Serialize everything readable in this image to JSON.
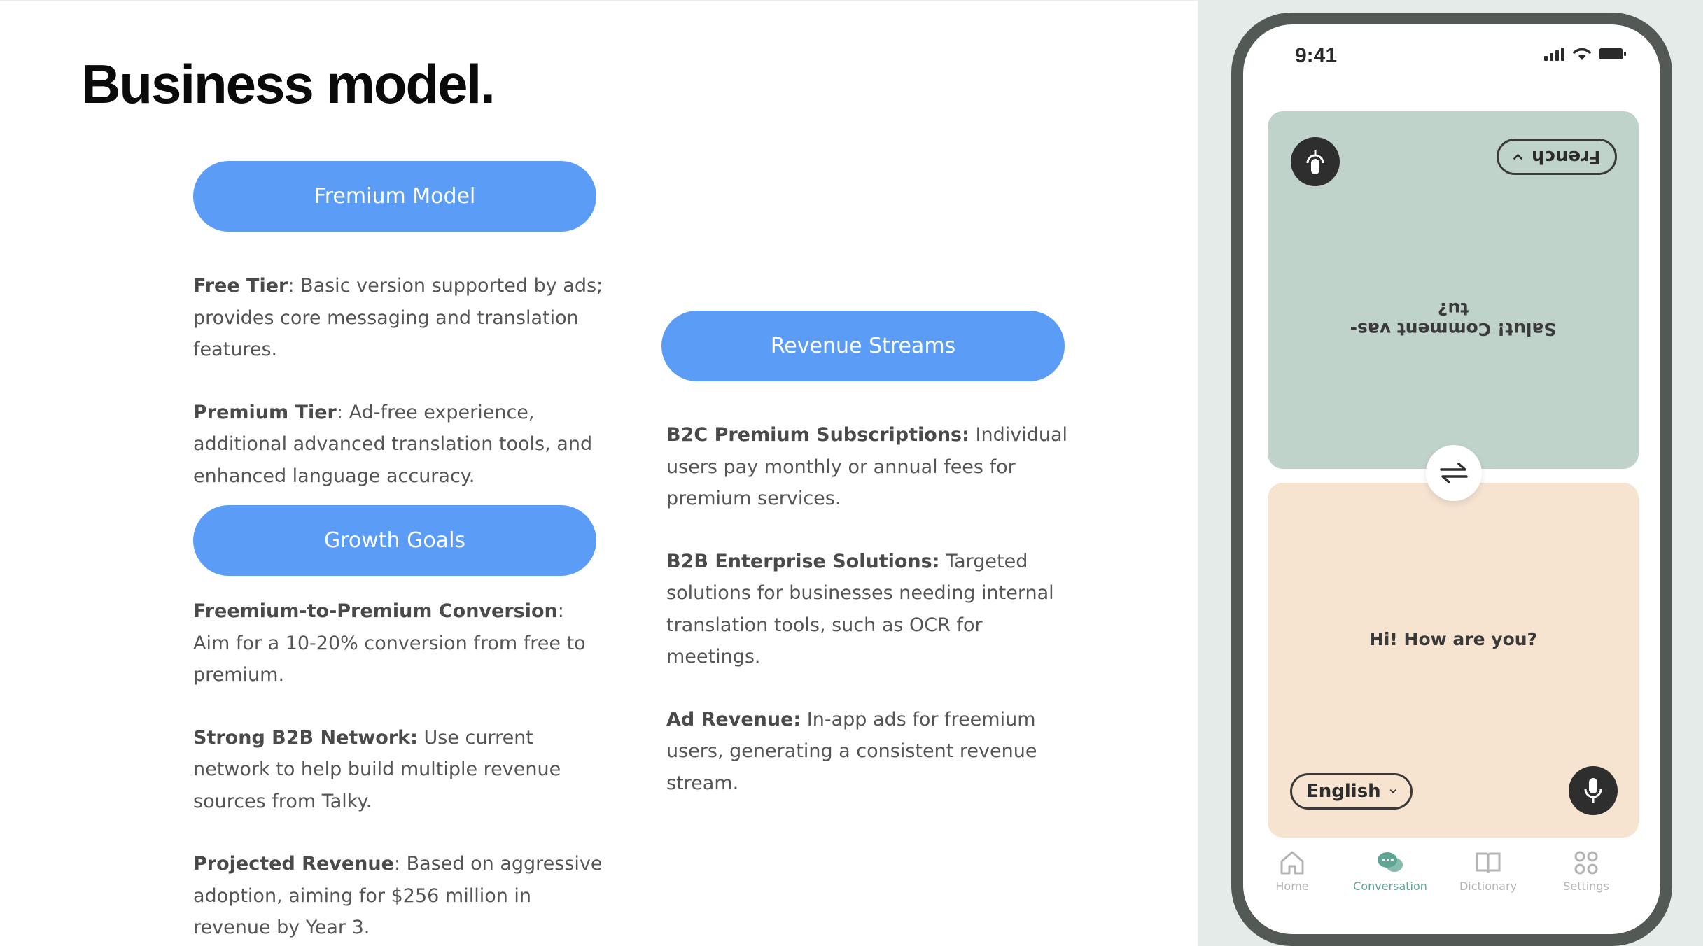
{
  "slide": {
    "title": "Business model."
  },
  "pills": {
    "fremium": "Fremium Model",
    "growth": "Growth Goals",
    "revenue": "Revenue Streams"
  },
  "fremium_items": [
    {
      "term": "Free Tier",
      "sep": ":",
      "text": " Basic version supported by ads; provides core messaging and translation features."
    },
    {
      "term": "Premium Tier",
      "sep": ":",
      "text": " Ad-free experience, additional advanced translation tools, and enhanced language accuracy."
    }
  ],
  "growth_items": [
    {
      "term": "Freemium-to-Premium Conversion",
      "sep": ":",
      "text": " Aim for a 10-20% conversion from free to premium."
    },
    {
      "term": "Strong B2B Network:",
      "sep": "",
      "text": " Use current network to help build multiple revenue sources from Talky."
    },
    {
      "term": "Projected Revenue",
      "sep": ":",
      "text": " Based on aggressive adoption, aiming for $256 million in revenue by Year 3."
    }
  ],
  "revenue_items": [
    {
      "term": "B2C Premium Subscriptions:",
      "sep": "",
      "text": " Individual users pay monthly or annual fees for premium services."
    },
    {
      "term": "B2B Enterprise Solutions:",
      "sep": "",
      "text": " Targeted solutions for businesses needing internal translation tools, such as OCR for meetings."
    },
    {
      "term": "Ad Revenue:",
      "sep": "",
      "text": " In-app ads for freemium users, generating a consistent revenue stream."
    }
  ],
  "phone": {
    "time": "9:41",
    "top_lang": "French",
    "top_phrase": "Salut! Comment vas-tu?",
    "bottom_lang": "English",
    "bottom_phrase": "Hi! How are you?",
    "nav": {
      "home": "Home",
      "conversation": "Conversation",
      "dictionary": "Dictionary",
      "settings": "Settings"
    },
    "colors": {
      "top_card": "#bfd3cb",
      "bottom_card": "#f6e4d1",
      "accent": "#5fa594"
    }
  },
  "colors": {
    "pill": "#5b9cf6",
    "body_text": "#555555"
  }
}
